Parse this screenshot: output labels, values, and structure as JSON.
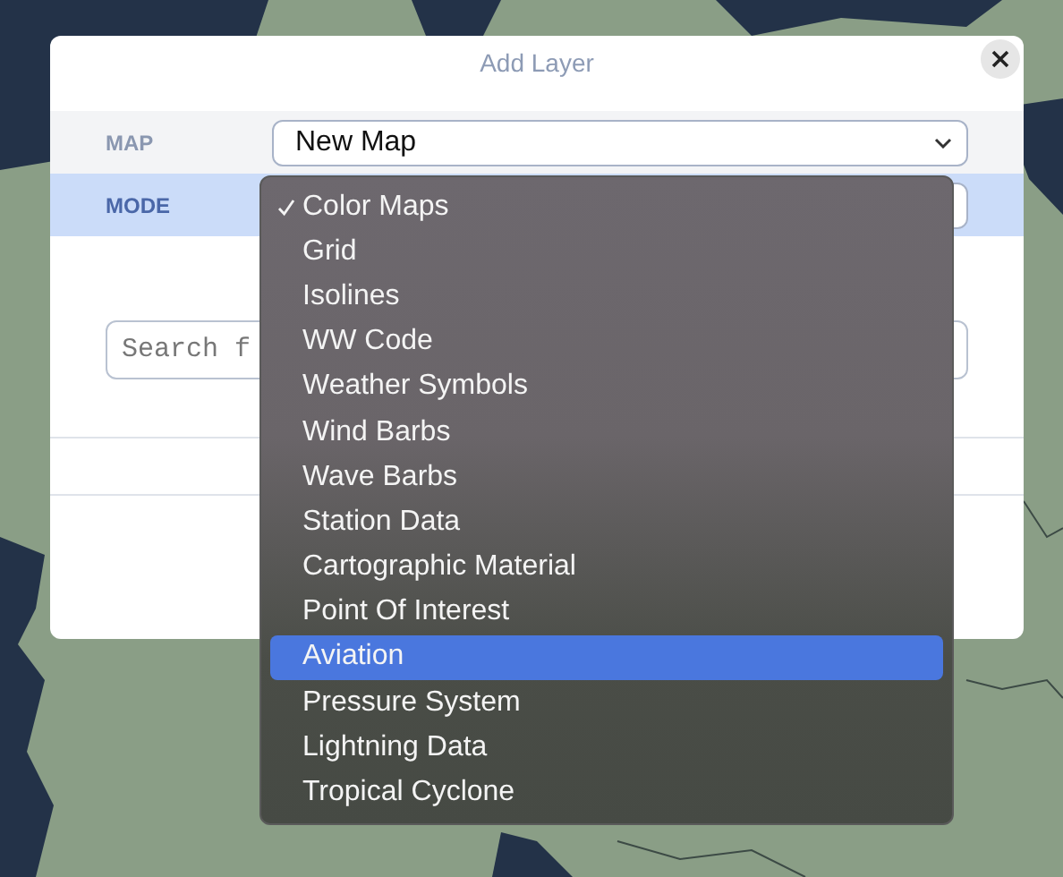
{
  "dialog": {
    "title": "Add Layer",
    "rows": [
      {
        "label": "MAP",
        "value": "New Map",
        "selected": false
      },
      {
        "label": "MODE",
        "selected": true
      }
    ],
    "search": {
      "placeholder": "Search f"
    }
  },
  "dropdown": {
    "options": [
      {
        "label": "Color Maps",
        "checked": true,
        "selected": false
      },
      {
        "label": "Grid",
        "checked": false,
        "selected": false
      },
      {
        "label": "Isolines",
        "checked": false,
        "selected": false
      },
      {
        "label": "WW Code",
        "checked": false,
        "selected": false
      },
      {
        "label": "Weather Symbols",
        "checked": false,
        "selected": false
      },
      {
        "label": "Wind Barbs",
        "checked": false,
        "selected": false
      },
      {
        "label": "Wave Barbs",
        "checked": false,
        "selected": false
      },
      {
        "label": "Station Data",
        "checked": false,
        "selected": false
      },
      {
        "label": "Cartographic Material",
        "checked": false,
        "selected": false
      },
      {
        "label": "Point Of Interest",
        "checked": false,
        "selected": false
      },
      {
        "label": "Aviation",
        "checked": false,
        "selected": true
      },
      {
        "label": "Pressure System",
        "checked": false,
        "selected": false
      },
      {
        "label": "Lightning Data",
        "checked": false,
        "selected": false
      },
      {
        "label": "Tropical Cyclone",
        "checked": false,
        "selected": false
      }
    ]
  }
}
